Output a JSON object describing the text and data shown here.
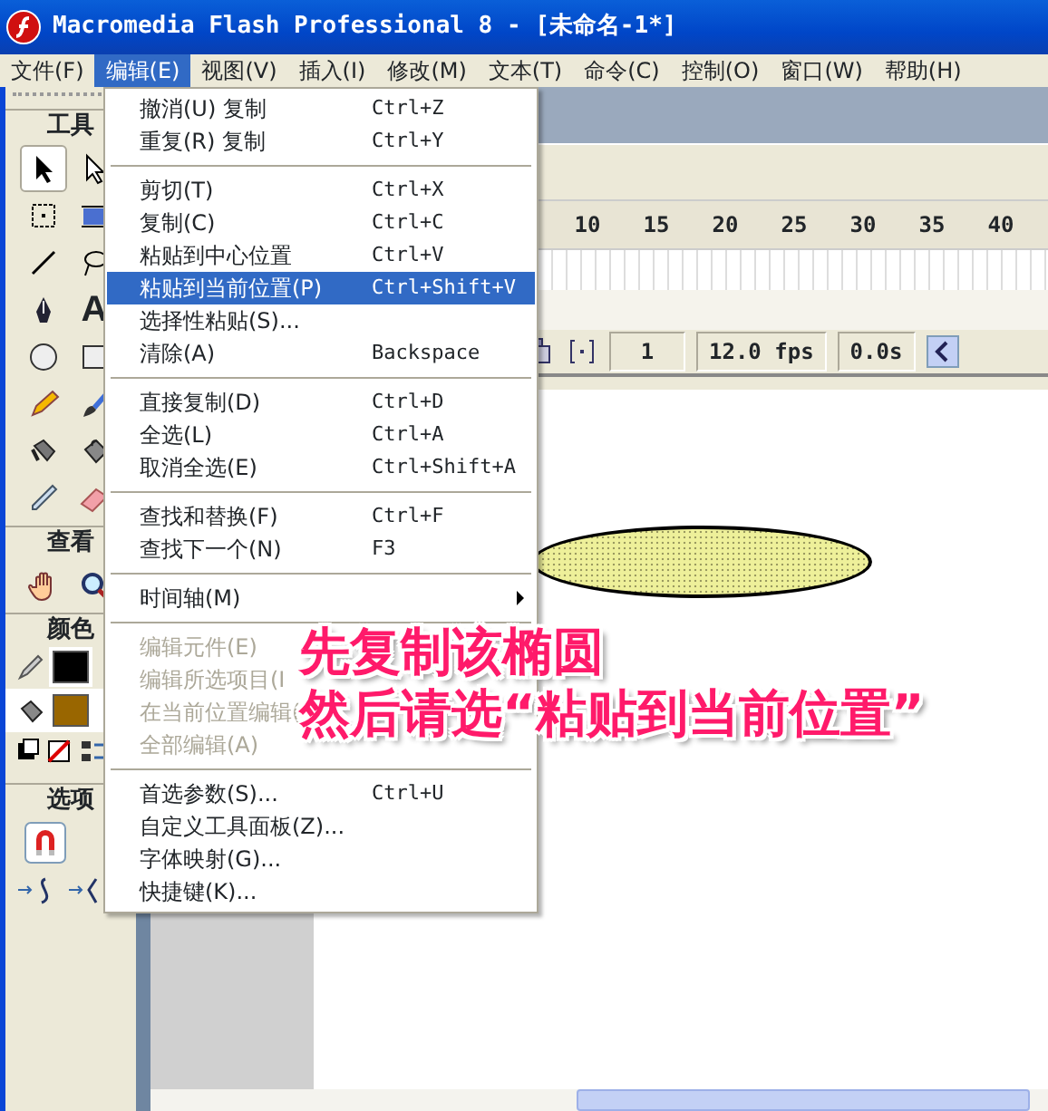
{
  "window": {
    "title": "Macromedia Flash Professional 8 - [未命名-1*]"
  },
  "menu_bar": [
    {
      "label": "文件(F)",
      "selected": false
    },
    {
      "label": "编辑(E)",
      "selected": true
    },
    {
      "label": "视图(V)",
      "selected": false
    },
    {
      "label": "插入(I)",
      "selected": false
    },
    {
      "label": "修改(M)",
      "selected": false
    },
    {
      "label": "文本(T)",
      "selected": false
    },
    {
      "label": "命令(C)",
      "selected": false
    },
    {
      "label": "控制(O)",
      "selected": false
    },
    {
      "label": "窗口(W)",
      "selected": false
    },
    {
      "label": "帮助(H)",
      "selected": false
    }
  ],
  "edit_menu": [
    {
      "kind": "item",
      "label": "撤消(U) 复制",
      "shortcut": "Ctrl+Z",
      "disabled": false,
      "selected": false
    },
    {
      "kind": "item",
      "label": "重复(R) 复制",
      "shortcut": "Ctrl+Y",
      "disabled": false,
      "selected": false
    },
    {
      "kind": "separator"
    },
    {
      "kind": "item",
      "label": "剪切(T)",
      "shortcut": "Ctrl+X",
      "disabled": false,
      "selected": false
    },
    {
      "kind": "item",
      "label": "复制(C)",
      "shortcut": "Ctrl+C",
      "disabled": false,
      "selected": false
    },
    {
      "kind": "item",
      "label": "粘贴到中心位置",
      "shortcut": "Ctrl+V",
      "disabled": false,
      "selected": false
    },
    {
      "kind": "item",
      "label": "粘贴到当前位置(P)",
      "shortcut": "Ctrl+Shift+V",
      "disabled": false,
      "selected": true
    },
    {
      "kind": "item",
      "label": "选择性粘贴(S)...",
      "disabled": false,
      "selected": false
    },
    {
      "kind": "item",
      "label": "清除(A)",
      "shortcut": "Backspace",
      "disabled": false,
      "selected": false
    },
    {
      "kind": "separator"
    },
    {
      "kind": "item",
      "label": "直接复制(D)",
      "shortcut": "Ctrl+D",
      "disabled": false,
      "selected": false
    },
    {
      "kind": "item",
      "label": "全选(L)",
      "shortcut": "Ctrl+A",
      "disabled": false,
      "selected": false
    },
    {
      "kind": "item",
      "label": "取消全选(E)",
      "shortcut": "Ctrl+Shift+A",
      "disabled": false,
      "selected": false
    },
    {
      "kind": "separator"
    },
    {
      "kind": "item",
      "label": "查找和替换(F)",
      "shortcut": "Ctrl+F",
      "disabled": false,
      "selected": false
    },
    {
      "kind": "item",
      "label": "查找下一个(N)",
      "shortcut": "F3",
      "disabled": false,
      "selected": false
    },
    {
      "kind": "separator"
    },
    {
      "kind": "submenu",
      "label": "时间轴(M)",
      "disabled": false,
      "selected": false
    },
    {
      "kind": "separator"
    },
    {
      "kind": "item",
      "label": "编辑元件(E)",
      "disabled": true,
      "selected": false
    },
    {
      "kind": "item",
      "label": "编辑所选项目(I",
      "disabled": true,
      "selected": false
    },
    {
      "kind": "item",
      "label": "在当前位置编辑(",
      "disabled": true,
      "selected": false
    },
    {
      "kind": "item",
      "label": "全部编辑(A)",
      "disabled": true,
      "selected": false
    },
    {
      "kind": "separator"
    },
    {
      "kind": "item",
      "label": "首选参数(S)...",
      "shortcut": "Ctrl+U",
      "disabled": false,
      "selected": false
    },
    {
      "kind": "item",
      "label": "自定义工具面板(Z)...",
      "disabled": false,
      "selected": false
    },
    {
      "kind": "item",
      "label": "字体映射(G)...",
      "disabled": false,
      "selected": false
    },
    {
      "kind": "item",
      "label": "快捷键(K)...",
      "disabled": false,
      "selected": false
    }
  ],
  "toolbox": {
    "title": "工具",
    "tools": [
      {
        "kind": "arrow",
        "selected": true
      },
      {
        "kind": "subselect",
        "selected": false
      },
      {
        "kind": "transform",
        "selected": false
      },
      {
        "kind": "gradient",
        "selected": false
      },
      {
        "kind": "line",
        "selected": false
      },
      {
        "kind": "lasso",
        "selected": false
      },
      {
        "kind": "pen",
        "selected": false
      },
      {
        "kind": "text",
        "label": "A",
        "selected": false
      },
      {
        "kind": "oval",
        "selected": false
      },
      {
        "kind": "rect",
        "selected": false
      },
      {
        "kind": "pencil",
        "selected": false
      },
      {
        "kind": "brush",
        "selected": false
      },
      {
        "kind": "ink",
        "selected": false
      },
      {
        "kind": "bucket",
        "selected": false
      },
      {
        "kind": "dropper",
        "selected": false
      },
      {
        "kind": "eraser",
        "selected": false
      }
    ],
    "view_title": "查看",
    "view_tools": [
      {
        "kind": "hand",
        "selected": false
      },
      {
        "kind": "zoom",
        "selected": false
      }
    ],
    "color_title": "颜色",
    "color_swatches": [
      {
        "kind": "stroke",
        "color": "#000000"
      },
      {
        "kind": "fill",
        "color": "#996600"
      }
    ],
    "options_title": "选项"
  },
  "timeline": {
    "ruler": [
      "10",
      "15",
      "20",
      "25",
      "30",
      "35",
      "40"
    ],
    "current_frame": "1",
    "frame_rate": "12.0 fps",
    "elapsed_time": "0.0s"
  },
  "annotation": [
    "先复制该椭圆",
    "然后请选“粘贴到当前位置”"
  ]
}
